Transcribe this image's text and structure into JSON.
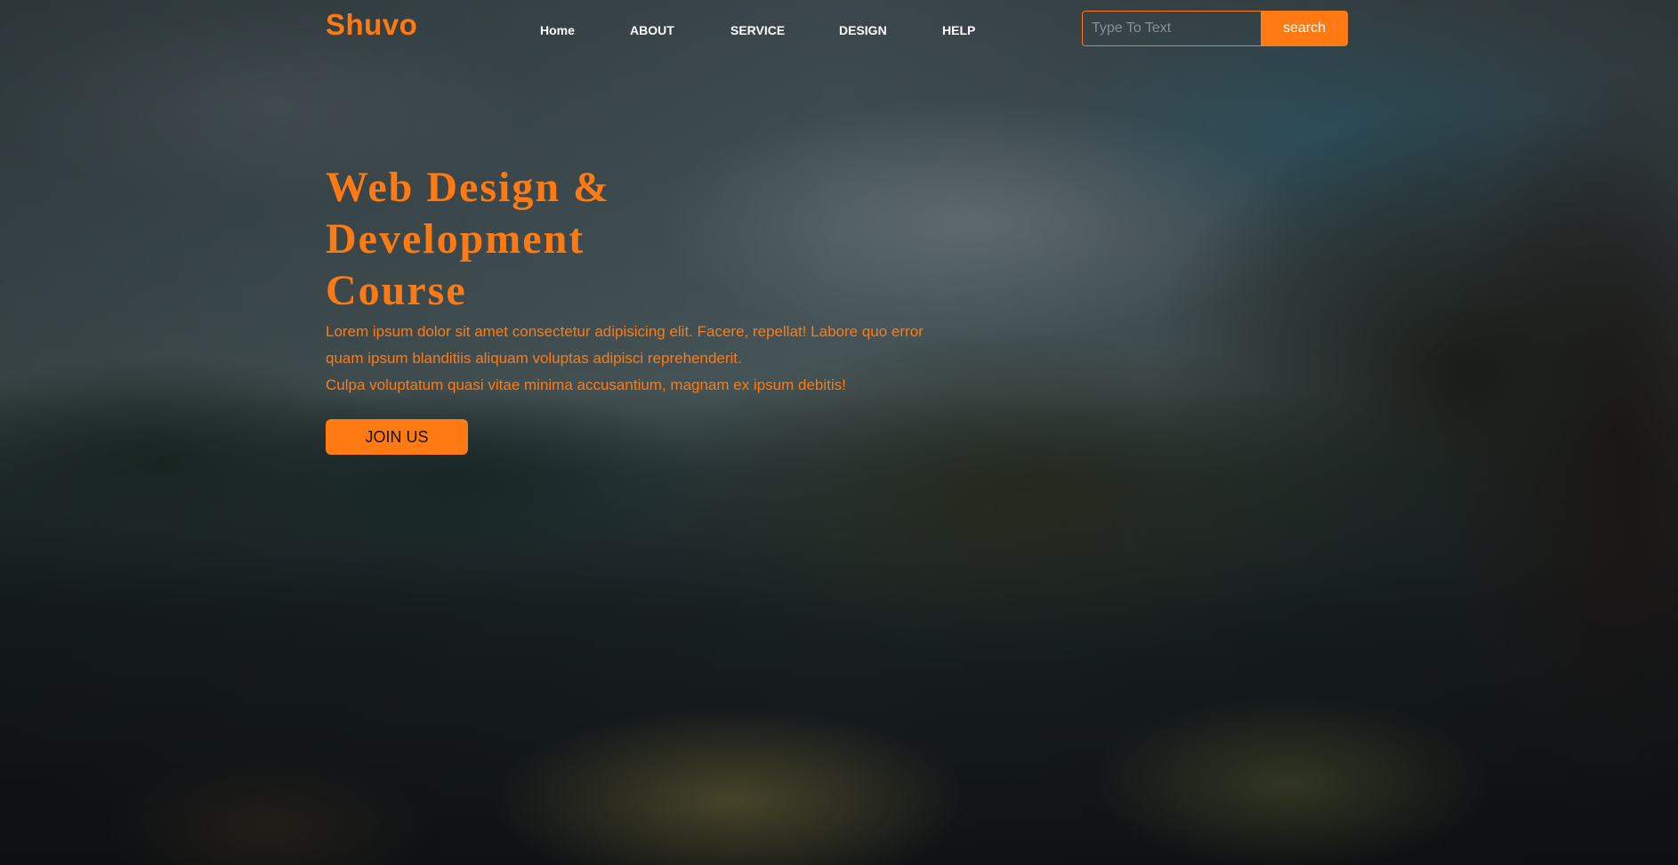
{
  "brand": {
    "logo_text": "Shuvo",
    "accent_color": "#ff7a12"
  },
  "nav": {
    "items": [
      {
        "label": "Home"
      },
      {
        "label": "ABOUT"
      },
      {
        "label": "SERVICE"
      },
      {
        "label": "DESIGN"
      },
      {
        "label": "HELP"
      }
    ]
  },
  "search": {
    "placeholder": "Type To Text",
    "value": "",
    "button_label": "search"
  },
  "hero": {
    "title_lines": [
      "Web Design &",
      "Development",
      "Course"
    ],
    "text_lines": [
      "Lorem ipsum dolor sit amet consectetur adipisicing elit. Facere, repellat! Labore quo error",
      "quam ipsum blanditiis aliquam voluptas adipisci reprehenderit.",
      "Culpa voluptatum quasi vitae minima accusantium, magnam ex ipsum debitis!"
    ],
    "cta_label": "JOIN US"
  }
}
